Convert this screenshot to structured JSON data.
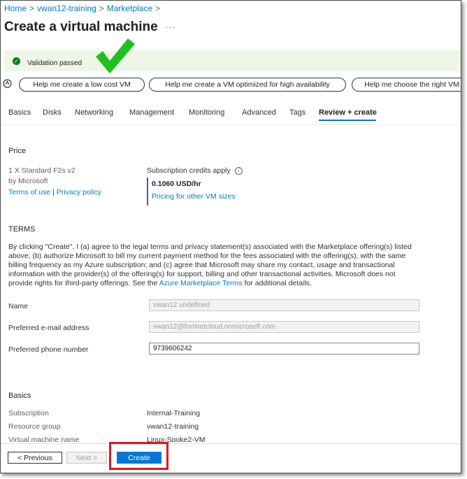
{
  "breadcrumb": {
    "items": [
      "Home",
      "vwan12-training",
      "Marketplace"
    ],
    "separator": ">"
  },
  "page": {
    "title": "Create a virtual machine",
    "more": "···"
  },
  "validation": {
    "icon": "checkmark-circle-icon",
    "text": "Validation passed",
    "color": "#107c10"
  },
  "copilot_prompts": [
    "Help me create a low cost VM",
    "Help me create a VM optimized for high availability",
    "Help me choose the right VM"
  ],
  "tabs": [
    {
      "label": "Basics"
    },
    {
      "label": "Disks"
    },
    {
      "label": "Networking"
    },
    {
      "label": "Management"
    },
    {
      "label": "Monitoring"
    },
    {
      "label": "Advanced"
    },
    {
      "label": "Tags"
    },
    {
      "label": "Review + create",
      "active": true
    }
  ],
  "price": {
    "heading": "Price",
    "product": "1 X Standard F2s v2",
    "publisher": "by Microsoft",
    "terms_link": "Terms of use",
    "divider": "|",
    "privacy_link": "Privacy policy",
    "credits_label": "Subscription credits apply",
    "rate": "0.1060 USD/hr",
    "pricing_link": "Pricing for other VM sizes"
  },
  "terms": {
    "heading": "TERMS",
    "body_before_link": "By clicking \"Create\", I (a) agree to the legal terms and privacy statement(s) associated with the Marketplace offering(s) listed above; (b) authorize Microsoft to bill my current payment method for the fees associated with the offering(s), with the same billing frequency as my Azure subscription; and (c) agree that Microsoft may share my contact, usage and transactional information with the provider(s) of the offering(s) for support, billing and other transactional activities. Microsoft does not provide rights for third-party offerings. See the ",
    "link": "Azure Marketplace Terms",
    "body_after_link": " for additional details."
  },
  "contact": {
    "name_label": "Name",
    "name_value": "vwan12 undefined",
    "email_label": "Preferred e-mail address",
    "email_value": "vwan12@fortinetcloud.onmicrosoft.com",
    "phone_label": "Preferred phone number",
    "phone_value": "9739606242"
  },
  "basics": {
    "heading": "Basics",
    "subscription_label": "Subscription",
    "subscription_value": "Internal-Training",
    "resource_group_label": "Resource group",
    "resource_group_value": "vwan12-training",
    "vm_name_label": "Virtual machine name",
    "vm_name_value": "Linux-Spoke2-VM"
  },
  "footer": {
    "previous": "< Previous",
    "next": "Next >",
    "create": "Create"
  },
  "colors": {
    "accent": "#0078d4",
    "success": "#107c10",
    "highlight": "#e81123",
    "annotation_check": "#1fbf1f"
  }
}
